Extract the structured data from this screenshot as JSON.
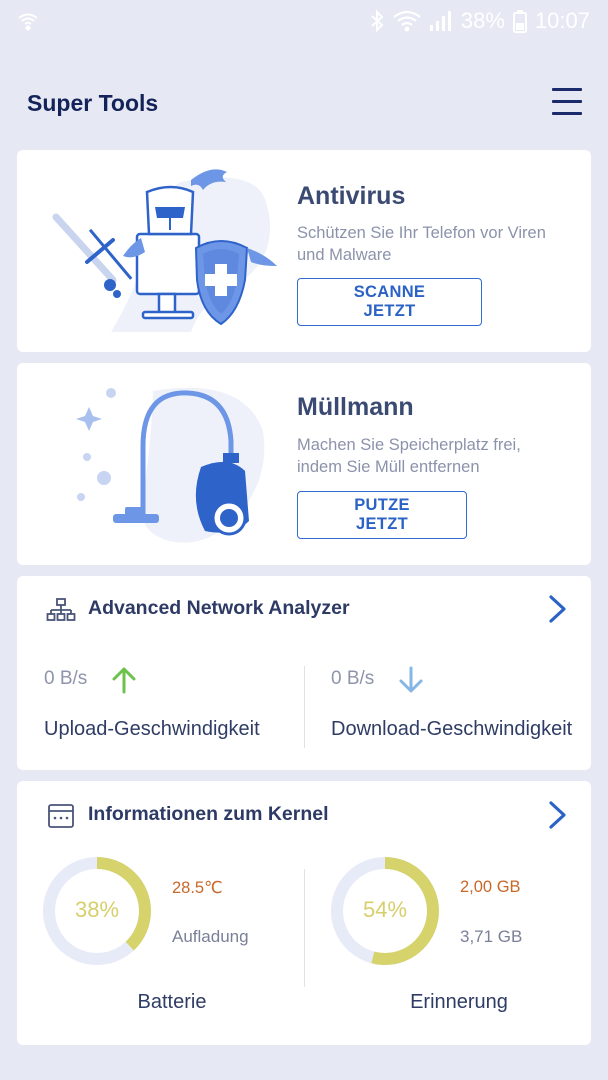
{
  "status_bar": {
    "battery_percent": "38%",
    "time": "10:07",
    "icons": [
      "wifi-hotspot-icon",
      "bluetooth-icon",
      "wifi-icon",
      "signal-icon",
      "battery-icon"
    ]
  },
  "app": {
    "title": "Super Tools",
    "menu_icon": "hamburger-menu-icon"
  },
  "antivirus": {
    "title": "Antivirus",
    "description": "Schützen Sie Ihr Telefon vor Viren und Malware",
    "button": "SCANNE JETZT"
  },
  "cleaner": {
    "title": "Müllmann",
    "description": "Machen Sie Speicherplatz frei, indem Sie Müll entfernen",
    "button": "PUTZE JETZT"
  },
  "network": {
    "title": "Advanced Network Analyzer",
    "upload": {
      "value": "0 B/s",
      "label": "Upload-Geschwindigkeit"
    },
    "download": {
      "value": "0 B/s",
      "label": "Download-Geschwindigkeit"
    }
  },
  "kernel": {
    "title": "Informationen zum Kernel",
    "battery": {
      "percent_label": "38%",
      "percent": 38,
      "temperature": "28.5℃",
      "state": "Aufladung",
      "label": "Batterie"
    },
    "memory": {
      "percent_label": "54%",
      "percent": 54,
      "used": "2,00 GB",
      "total": "3,71 GB",
      "label": "Erinnerung"
    }
  },
  "colors": {
    "background": "#e6e9f3",
    "accent": "#2b62c6",
    "gauge_fill": "#d6d36c",
    "gauge_track": "#e7ebf7",
    "upload_arrow": "#6cc24a",
    "download_arrow": "#86b6e6",
    "temperature": "#c8692a"
  }
}
